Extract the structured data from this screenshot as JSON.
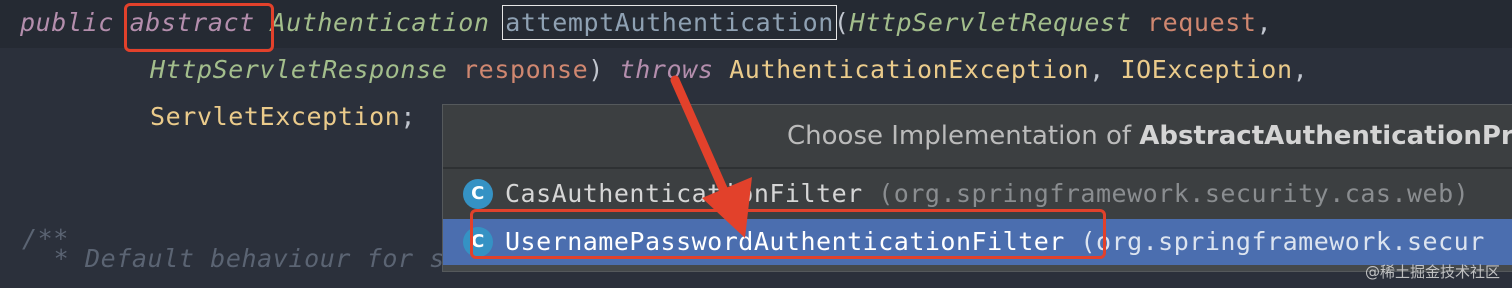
{
  "code": {
    "line1": {
      "kw_public": "public",
      "kw_abstract": "abstract",
      "return_type": "Authentication",
      "method_name": "attemptAuthentication",
      "open_paren": "(",
      "param1_type": "HttpServletRequest",
      "param1_name": "request",
      "comma": ","
    },
    "line2": {
      "param2_type": "HttpServletResponse",
      "param2_name": "response",
      "close_paren": ")",
      "kw_throws": "throws",
      "exc1": "AuthenticationException",
      "comma1": ",",
      "exc2": "IOException",
      "comma2": ","
    },
    "line3": {
      "exc3": "ServletException",
      "semicolon": ";"
    },
    "comment_start": "/**",
    "comment_text": " * Default behaviour for s"
  },
  "popup": {
    "title_prefix": "Choose Implementation of ",
    "title_bold": "AbstractAuthenticationPr",
    "items": [
      {
        "icon_letter": "C",
        "icon_name": "class-icon",
        "class_name": "CasAuthenticationFilter",
        "package": "(org.springframework.security.cas.web)"
      },
      {
        "icon_letter": "C",
        "icon_name": "class-icon",
        "class_name": "UsernamePasswordAuthenticationFilter",
        "package": "(org.springframework.secur"
      }
    ]
  },
  "annotation": {
    "highlight_color": "#e2412b"
  },
  "watermark": "@稀土掘金技术社区"
}
